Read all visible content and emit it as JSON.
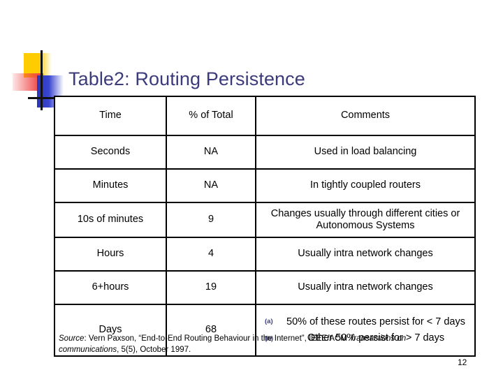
{
  "slide": {
    "title": "Table2: Routing Persistence",
    "page_number": "12",
    "title_color": "#3B3A7A",
    "marker_color": "#3B3A7A"
  },
  "decoration": {
    "yellow": "#FFCC00",
    "red": "#F04040",
    "blue": "#2B35B8",
    "line": "#111111"
  },
  "table": {
    "headers": {
      "time": "Time",
      "percent": "% of Total",
      "comments": "Comments"
    },
    "rows": [
      {
        "time": "Seconds",
        "percent": "NA",
        "comment": "Used in load balancing"
      },
      {
        "time": "Minutes",
        "percent": "NA",
        "comment": "In tightly coupled routers"
      },
      {
        "time": "10s of minutes",
        "percent": "9",
        "comment": "Changes usually through different cities or Autonomous Systems"
      },
      {
        "time": "Hours",
        "percent": "4",
        "comment": "Usually intra network changes"
      },
      {
        "time": "6+hours",
        "percent": "19",
        "comment": "Usually intra network changes"
      }
    ],
    "last_row": {
      "time": "Days",
      "percent": "68",
      "notes": [
        {
          "marker": "(a)",
          "text": "50% of these routes persist for < 7 days"
        },
        {
          "marker": "(b)",
          "text": "Other 50% persist for > 7 days"
        }
      ]
    }
  },
  "source": {
    "label": "Source",
    "separator": ": ",
    "authors_and_title": "Vern Paxson, “End-to-End Routing Behaviour in the Internet”, IEEE/ACM ",
    "journal": "Transactions on communications",
    "details": ", 5(5), October 1997."
  }
}
